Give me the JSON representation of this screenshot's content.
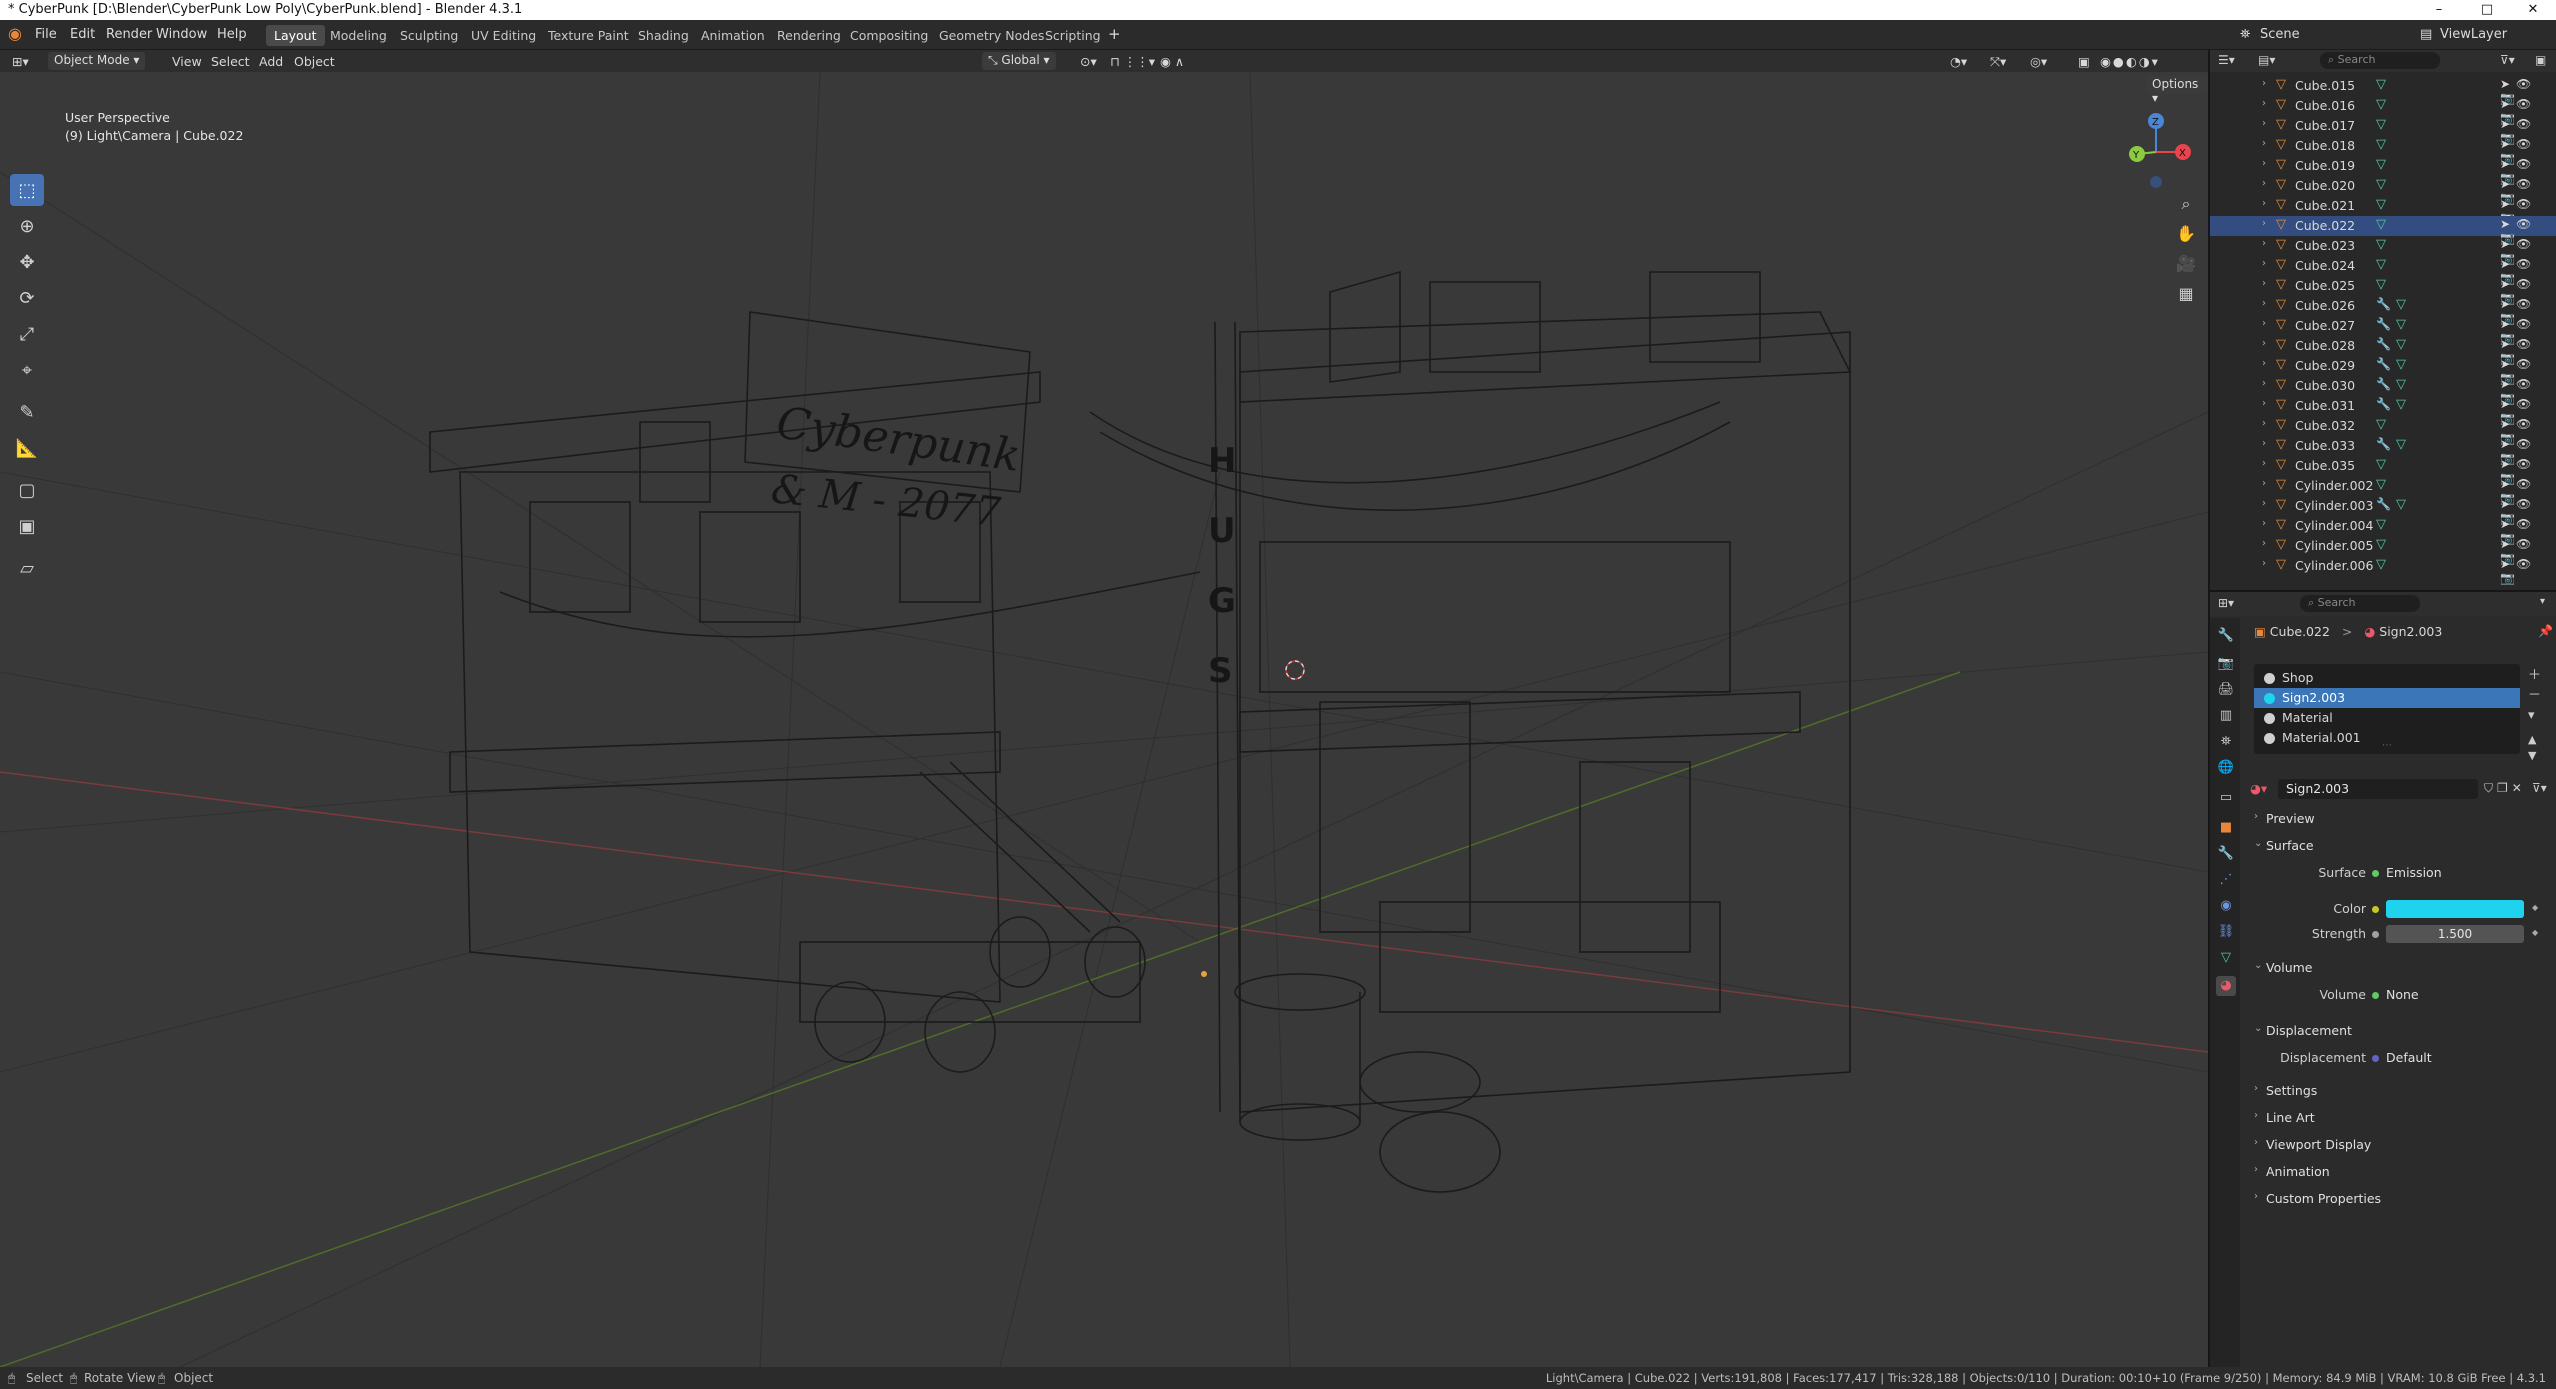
{
  "titlebar": {
    "title": "* CyberPunk [D:\\Blender\\CyberPunk Low Poly\\CyberPunk.blend] - Blender 4.3.1",
    "minimize": "–",
    "maximize": "□",
    "close": "✕"
  },
  "menu": [
    "File",
    "Edit",
    "Render",
    "Window",
    "Help"
  ],
  "workspaces": [
    "Layout",
    "Modeling",
    "Sculpting",
    "UV Editing",
    "Texture Paint",
    "Shading",
    "Animation",
    "Rendering",
    "Compositing",
    "Geometry Nodes",
    "Scripting"
  ],
  "add_workspace": "+",
  "scene_label": "Scene",
  "viewlayer_label": "ViewLayer",
  "viewport": {
    "mode": "Object Mode",
    "menus": [
      "View",
      "Select",
      "Add",
      "Object"
    ],
    "transform_orientation": "Global",
    "options": "Options",
    "perspective": "User Perspective",
    "context": "(9) Light\\Camera | Cube.022",
    "overlay": {
      "title": [
        "Cyberpunk",
        "& M - 2077"
      ],
      "pole_letters": [
        "H",
        "U",
        "G",
        "S"
      ]
    },
    "gizmo": {
      "z": "Z",
      "x": "X",
      "y": "Y"
    }
  },
  "outliner": {
    "search_placeholder": "Search",
    "items": [
      {
        "name": "Cube.015",
        "mod": false,
        "selected": false
      },
      {
        "name": "Cube.016",
        "mod": false,
        "selected": false
      },
      {
        "name": "Cube.017",
        "mod": false,
        "selected": false
      },
      {
        "name": "Cube.018",
        "mod": false,
        "selected": false
      },
      {
        "name": "Cube.019",
        "mod": false,
        "selected": false
      },
      {
        "name": "Cube.020",
        "mod": false,
        "selected": false
      },
      {
        "name": "Cube.021",
        "mod": false,
        "selected": false
      },
      {
        "name": "Cube.022",
        "mod": false,
        "selected": true
      },
      {
        "name": "Cube.023",
        "mod": false,
        "selected": false
      },
      {
        "name": "Cube.024",
        "mod": false,
        "selected": false
      },
      {
        "name": "Cube.025",
        "mod": false,
        "selected": false
      },
      {
        "name": "Cube.026",
        "mod": true,
        "selected": false
      },
      {
        "name": "Cube.027",
        "mod": true,
        "selected": false
      },
      {
        "name": "Cube.028",
        "mod": true,
        "selected": false
      },
      {
        "name": "Cube.029",
        "mod": true,
        "selected": false
      },
      {
        "name": "Cube.030",
        "mod": true,
        "selected": false
      },
      {
        "name": "Cube.031",
        "mod": true,
        "selected": false
      },
      {
        "name": "Cube.032",
        "mod": false,
        "selected": false
      },
      {
        "name": "Cube.033",
        "mod": true,
        "selected": false
      },
      {
        "name": "Cube.035",
        "mod": false,
        "selected": false
      },
      {
        "name": "Cylinder.002",
        "mod": false,
        "selected": false
      },
      {
        "name": "Cylinder.003",
        "mod": true,
        "selected": false
      },
      {
        "name": "Cylinder.004",
        "mod": false,
        "selected": false
      },
      {
        "name": "Cylinder.005",
        "mod": false,
        "selected": false
      },
      {
        "name": "Cylinder.006",
        "mod": false,
        "selected": false
      }
    ]
  },
  "properties": {
    "search_placeholder": "Search",
    "breadcrumb": {
      "object": "Cube.022",
      "sep": ">",
      "material": "Sign2.003"
    },
    "slots": [
      "Shop",
      "Sign2.003",
      "Material",
      "Material.001"
    ],
    "selected_slot": 1,
    "material_name": "Sign2.003",
    "panels": {
      "preview": "Preview",
      "surface": "Surface",
      "volume": "Volume",
      "displacement": "Displacement",
      "settings": "Settings",
      "line_art": "Line Art",
      "viewport_display": "Viewport Display",
      "animation": "Animation",
      "custom_properties": "Custom Properties"
    },
    "surface": {
      "surface_label": "Surface",
      "surface_value": "Emission",
      "color_label": "Color",
      "color_value": "#1fd3ee",
      "strength_label": "Strength",
      "strength_value": "1.500"
    },
    "volume": {
      "label": "Volume",
      "value": "None"
    },
    "displacement": {
      "label": "Displacement",
      "value": "Default"
    }
  },
  "statusbar": {
    "select": "Select",
    "rotate": "Rotate View",
    "object": "Object",
    "stats": "Light\\Camera | Cube.022 | Verts:191,808 | Faces:177,417 | Tris:328,188 | Objects:0/110 | Duration: 00:10+10 (Frame 9/250) | Memory: 84.9 MiB | VRAM: 10.8 GiB Free | 4.3.1"
  },
  "colors": {
    "accent": "#4772b3",
    "selection": "#3a76b8",
    "emission": "#1fd3ee",
    "x_axis": "#e8444e",
    "y_axis": "#8acb3f",
    "z_axis": "#4a86d8"
  }
}
